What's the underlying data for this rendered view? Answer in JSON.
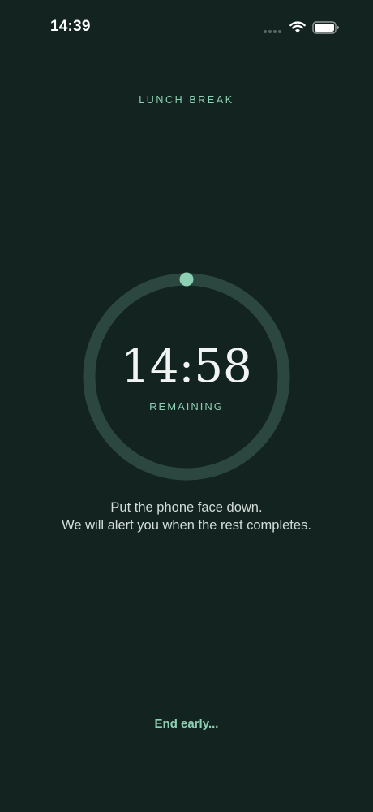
{
  "status_bar": {
    "time": "14:39",
    "icons": [
      "signal-dots-icon",
      "wifi-icon",
      "battery-icon"
    ]
  },
  "session": {
    "title": "LUNCH BREAK"
  },
  "timer": {
    "value": "14:58",
    "label": "REMAINING",
    "progress_fraction": 0.0
  },
  "message": {
    "line1": "Put the phone face down.",
    "line2": "We will alert you when the rest completes."
  },
  "actions": {
    "end_label": "End early..."
  },
  "colors": {
    "background": "#132420",
    "accent": "#8ed0b3",
    "ring_track": "#2c4740",
    "text_primary": "#f1f4f2",
    "text_secondary": "#d3dcd8"
  }
}
